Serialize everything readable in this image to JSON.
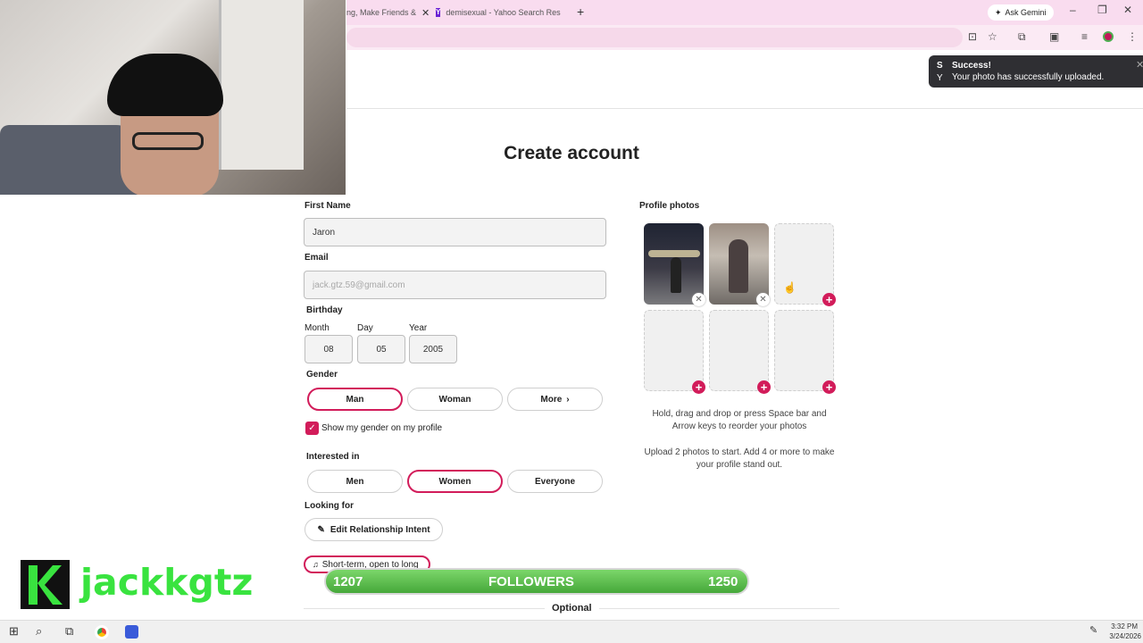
{
  "browser": {
    "tabs": [
      {
        "label": "ng, Make Friends &",
        "close": "✕"
      },
      {
        "label": "demisexual - Yahoo Search Res",
        "close": "✕"
      }
    ],
    "new_tab": "+",
    "ask_gemini": "Ask Gemini"
  },
  "toast": {
    "prefix_s": "S",
    "prefix_y": "Y",
    "title": "Success!",
    "message": "Your photo has successfully uploaded.",
    "close": "✕"
  },
  "page": {
    "title": "Create account"
  },
  "form": {
    "first_name_label": "First Name",
    "first_name_value": "Jaron",
    "email_label": "Email",
    "email_placeholder": "jack.gtz.59@gmail.com",
    "birthday_label": "Birthday",
    "month_label": "Month",
    "day_label": "Day",
    "year_label": "Year",
    "month_value": "08",
    "day_value": "05",
    "year_value": "2005",
    "gender_label": "Gender",
    "gender_options": [
      "Man",
      "Woman",
      "More"
    ],
    "gender_selected": "Man",
    "show_gender_label": "Show my gender on my profile",
    "show_gender_checked": true,
    "interested_label": "Interested in",
    "interested_options": [
      "Men",
      "Women",
      "Everyone"
    ],
    "interested_selected": "Women",
    "looking_for_label": "Looking for",
    "edit_intent_label": "Edit Relationship Intent",
    "intent_chip": "Short-term, open to long",
    "optional_label": "Optional"
  },
  "photos": {
    "label": "Profile photos",
    "filled_count": 2,
    "total_slots": 6,
    "hint_reorder": "Hold, drag and drop or press Space bar and Arrow keys to reorder your photos",
    "hint_upload": "Upload 2 photos to start. Add 4 or more to make your profile stand out."
  },
  "overlay": {
    "streamer_name": "jackkgtz",
    "followers_label": "FOLLOWERS",
    "followers_current": "1207",
    "followers_goal": "1250"
  },
  "taskbar": {
    "time": "3:32 PM",
    "date": "3/24/2026"
  },
  "colors": {
    "accent": "#d21c5a",
    "tabbar": "#f9dcef",
    "followers_green": "#46a83a",
    "streamer_green": "#39e33f"
  }
}
